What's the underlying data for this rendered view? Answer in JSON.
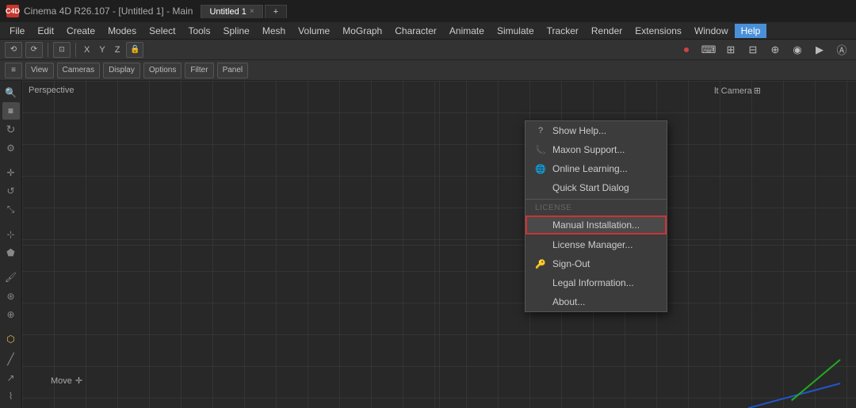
{
  "app": {
    "title": "Cinema 4D R26.107 - [Untitled 1] - Main",
    "icon": "C4D"
  },
  "tab": {
    "label": "Untitled 1",
    "close": "×",
    "add": "+"
  },
  "menu": {
    "items": [
      "File",
      "Edit",
      "Create",
      "Modes",
      "Select",
      "Tools",
      "Spline",
      "Mesh",
      "Volume",
      "MoGraph",
      "Character",
      "Animate",
      "Simulate",
      "Tracker",
      "Render",
      "Extensions",
      "Window",
      "Help"
    ]
  },
  "toolbar1": {
    "buttons": [
      "⟲",
      "⟳"
    ],
    "coords": {
      "x": "X",
      "y": "Y",
      "z": "Z"
    },
    "lock_icon": "🔒"
  },
  "viewport": {
    "label": "Perspective",
    "camera_label": "lt Camera",
    "camera_icon": "⊞"
  },
  "help_menu": {
    "items": [
      {
        "id": "show-help",
        "label": "Show Help...",
        "icon": "?"
      },
      {
        "id": "maxon-support",
        "label": "Maxon Support...",
        "icon": "📞"
      },
      {
        "id": "online-learning",
        "label": "Online Learning...",
        "icon": "🌐"
      },
      {
        "id": "quick-start-dialog",
        "label": "Quick Start Dialog",
        "icon": ""
      }
    ],
    "section_license": "License",
    "highlighted_item": {
      "id": "manual-installation",
      "label": "Manual Installation...",
      "icon": ""
    },
    "items2": [
      {
        "id": "license-manager",
        "label": "License Manager...",
        "icon": ""
      },
      {
        "id": "sign-out",
        "label": "Sign-Out",
        "icon": "🔑"
      },
      {
        "id": "legal-information",
        "label": "Legal Information...",
        "icon": ""
      },
      {
        "id": "about",
        "label": "About...",
        "icon": ""
      }
    ]
  },
  "status": {
    "move_label": "Move",
    "move_icon": "✛"
  },
  "colors": {
    "accent": "#4a90d9",
    "highlight_border": "#cc3333",
    "viewport_bg": "#282828"
  }
}
